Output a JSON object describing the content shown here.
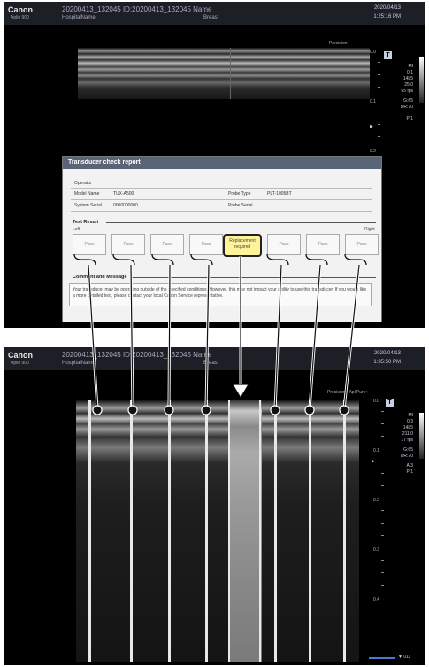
{
  "screen1": {
    "brand": "Canon",
    "brand_sub": "Aplio 900",
    "patient_id": "20200413_132045 ID:20200413_132045 Name",
    "hospital": "HospitalName",
    "exam": "Breast",
    "date": "2020/04/13",
    "time": "1:25:16 PM",
    "preset": "Precision+",
    "depth_labels": [
      "0.0",
      "0.1",
      "0.2"
    ],
    "params": [
      "MI",
      "0.1",
      "14L5",
      "25.0",
      "55 fps",
      "G:65",
      "DR:70",
      "P:1"
    ],
    "tbadge": "T"
  },
  "dialog": {
    "title": "Transducer check report",
    "operator_label": "Operator",
    "model_label": "Model Name",
    "model_value": "TUX-A500",
    "serial_label": "System Serial",
    "serial_value": "0000000000",
    "probe_type_label": "Probe Type",
    "probe_type_value": "PLT-1005BT",
    "probe_serial_label": "Probe Serial",
    "test_result_label": "Test Result",
    "left_label": "Left",
    "right_label": "Right",
    "results": [
      "Pass",
      "Pass",
      "Pass",
      "Pass",
      "Replacement required",
      "Pass",
      "Pass",
      "Pass"
    ],
    "comment_label": "Comment and Message",
    "comment_text": "Your transducer may be operating outside of the specified conditions. However, this may not impact your ability to use this transducer. If you would like a more detailed test, please contact your local Canon Service representative."
  },
  "screen2": {
    "brand": "Canon",
    "brand_sub": "Aplio 900",
    "patient_id": "20200413_132045 ID:20200413_132045 Name",
    "hospital": "HospitalName",
    "exam": "Breast",
    "date": "2020/04/13",
    "time": "1:35:50 PM",
    "preset": "Precision+  ApliPure+",
    "depth_labels": [
      "0.0",
      "0.1",
      "0.2",
      "0.3",
      "0.4"
    ],
    "params": [
      "MI",
      "0.3",
      "14L5",
      "211.0",
      "17 fps",
      "G:65",
      "DR:70",
      "A:3",
      "P:1"
    ],
    "tbadge": "T",
    "fps_label": "▼ 011"
  },
  "colors": {
    "warning_fill": "#fff39a",
    "dialog_title_bar": "#5a6477",
    "scale_bar": "#4a7ad0"
  }
}
